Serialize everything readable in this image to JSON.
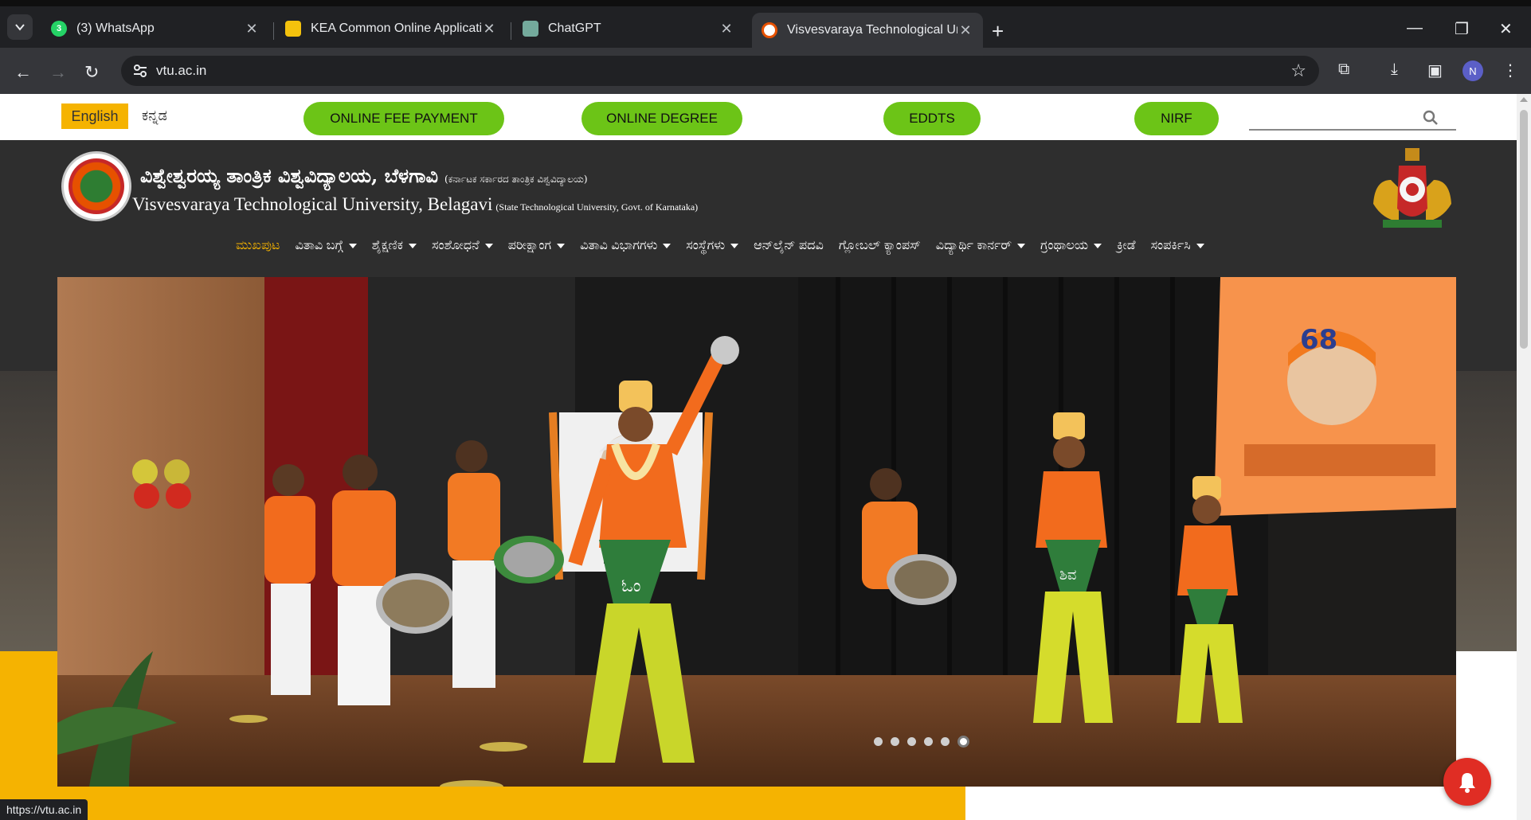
{
  "browser": {
    "tabs": [
      {
        "title": "(3) WhatsApp",
        "favicon": "whatsapp-icon",
        "badge": "3",
        "active": false
      },
      {
        "title": "KEA Common Online Applicatio",
        "favicon": "kea-icon",
        "active": false
      },
      {
        "title": "ChatGPT",
        "favicon": "chatgpt-icon",
        "active": false
      },
      {
        "title": "Visvesvaraya Technological Univ",
        "favicon": "vtu-icon",
        "active": true
      }
    ],
    "url": "vtu.ac.in",
    "profile_initial": "N",
    "status_url": "https://vtu.ac.in"
  },
  "topbar": {
    "lang_english": "English",
    "lang_kannada": "ಕನ್ನಡ",
    "buttons": [
      "ONLINE FEE PAYMENT",
      "ONLINE DEGREE",
      "EDDTS",
      "NIRF"
    ],
    "search_placeholder": ""
  },
  "header": {
    "name_kannada": "ವಿಶ್ವೇಶ್ವರಯ್ಯ ತಾಂತ್ರಿಕ ವಿಶ್ವವಿದ್ಯಾಲಯ, ಬೆಳಗಾವಿ",
    "sub_kannada": "(ಕರ್ನಾಟಕ ಸರ್ಕಾರದ ತಾಂತ್ರಿಕ ವಿಶ್ವವಿದ್ಯಾಲಯ)",
    "name_english": "Visvesvaraya Technological University, Belagavi",
    "sub_english": "(State Technological University, Govt. of Karnataka)"
  },
  "nav": [
    {
      "label": "ಮುಖಪುಟ",
      "dropdown": false,
      "active": true
    },
    {
      "label": "ವಿತಾವಿ ಬಗ್ಗೆ",
      "dropdown": true
    },
    {
      "label": "ಶೈಕ್ಷಣಿಕ",
      "dropdown": true
    },
    {
      "label": "ಸಂಶೋಧನೆ",
      "dropdown": true
    },
    {
      "label": "ಪರೀಕ್ಷಾಂಗ",
      "dropdown": true
    },
    {
      "label": "ವಿತಾವಿ ವಿಭಾಗಗಳು",
      "dropdown": true
    },
    {
      "label": "ಸಂಸ್ಥೆಗಳು",
      "dropdown": true
    },
    {
      "label": "ಆನ್‌ಲೈನ್ ಪದವಿ",
      "dropdown": false
    },
    {
      "label": "ಗ್ಲೋಬಲ್ ಕ್ಯಾಂಪಸ್",
      "dropdown": false
    },
    {
      "label": "ವಿದ್ಯಾರ್ಥಿ ಕಾರ್ನರ್",
      "dropdown": true
    },
    {
      "label": "ಗ್ರಂಥಾಲಯ",
      "dropdown": true
    },
    {
      "label": "ಕ್ರೀಡೆ",
      "dropdown": false
    },
    {
      "label": "ಸಂಪರ್ಕಿಸಿ",
      "dropdown": true
    }
  ],
  "slider": {
    "slide_count": 6,
    "active_index": 5,
    "shirt_text_1": "ಓಂ",
    "shirt_text_2": "ಶಿವ"
  },
  "colors": {
    "accent_yellow": "#f5b301",
    "pill_green": "#6cc417",
    "header_dark": "#2e2e2e",
    "bell_red": "#e02d24"
  }
}
